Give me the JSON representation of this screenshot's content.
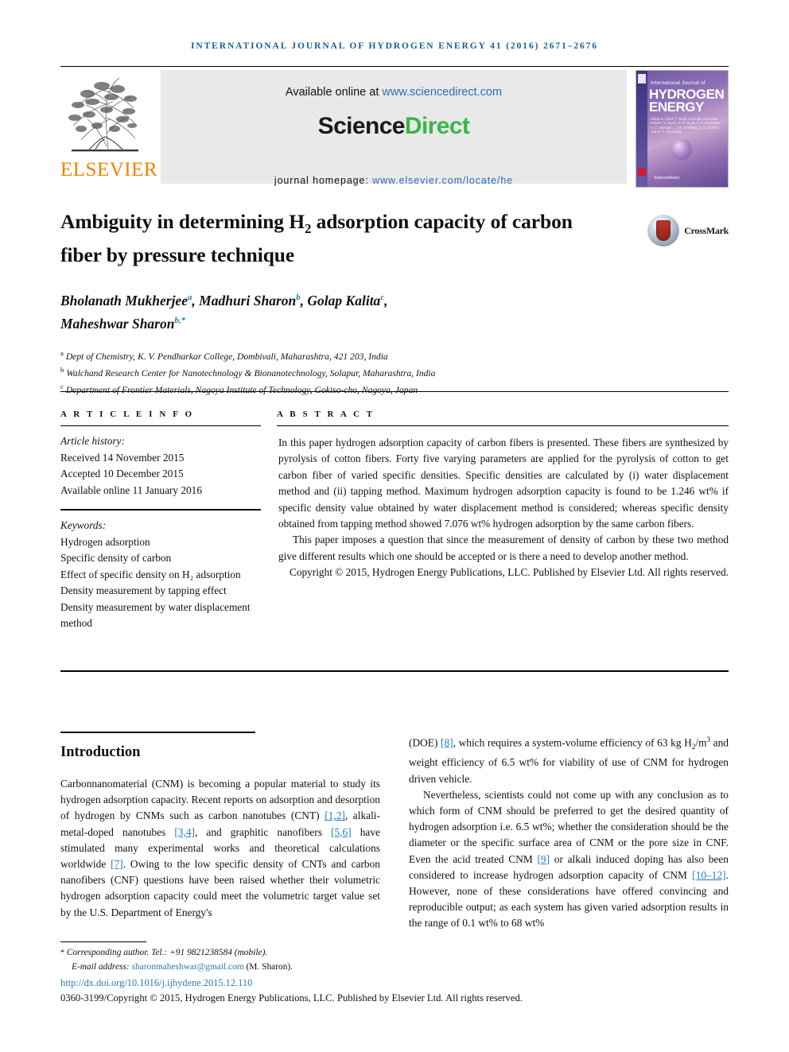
{
  "running_head": "INTERNATIONAL JOURNAL OF HYDROGEN ENERGY 41 (2016) 2671–2676",
  "header": {
    "publisher_name": "ELSEVIER",
    "available_prefix": "Available online at ",
    "sciencedirect_url": "www.sciencedirect.com",
    "sciencedirect_logo_part1": "Science",
    "sciencedirect_logo_part2": "Direct",
    "homepage_prefix": "journal homepage: ",
    "homepage_url": "www.elsevier.com/locate/he",
    "cover": {
      "top_small": "International Journal of",
      "title_line1": "HYDROGEN",
      "title_line2": "ENERGY",
      "editors": "Editor-in-Chief: T. Nejat Veziroğlu    Associate Editors: S. Dunn, D. S. Scott, A. S. Pedersen, A. C. Marsden, J. W. Sheffield, J. O. Bockris and D. A. Stevanidis",
      "science_direct": "ScienceDirect"
    }
  },
  "article": {
    "title_part1": "Ambiguity in determining H",
    "title_sub": "2",
    "title_part2": " adsorption capacity of carbon fiber by pressure technique",
    "crossmark_label": "CrossMark",
    "authors": [
      {
        "name": "Bholanath Mukherjee",
        "sup": "a",
        "sep": ", "
      },
      {
        "name": "Madhuri Sharon",
        "sup": "b",
        "sep": ", "
      },
      {
        "name": "Golap Kalita",
        "sup": "c",
        "sep": ", "
      },
      {
        "name": "Maheshwar Sharon",
        "sup": "b,*",
        "sep": ""
      }
    ],
    "affiliations": [
      {
        "mark": "a",
        "text": "Dept of Chemistry, K. V. Pendharkar College, Dombivali, Maharashtra, 421 203, India"
      },
      {
        "mark": "b",
        "text": "Walchand Research Center for Nanotechnology & Bionanotechnology, Solapur, Maharashtra, India"
      },
      {
        "mark": "c",
        "text": "Department of Frontier Materials, Nagoya Institute of Technology, Gokiso-cho, Nagoya, Japan"
      }
    ]
  },
  "article_info": {
    "heading": "A R T I C L E   I N F O",
    "history_label": "Article history:",
    "history": [
      "Received 14 November 2015",
      "Accepted 10 December 2015",
      "Available online 11 January 2016"
    ],
    "keywords_label": "Keywords:",
    "keywords": [
      "Hydrogen adsorption",
      "Specific density of carbon",
      "Effect of specific density on H₂ adsorption",
      "Density measurement by tapping effect",
      "Density measurement by water displacement method"
    ]
  },
  "abstract": {
    "heading": "A B S T R A C T",
    "paragraph1": "In this paper hydrogen adsorption capacity of carbon fibers is presented. These fibers are synthesized by pyrolysis of cotton fibers. Forty five varying parameters are applied for the pyrolysis of cotton to get carbon fiber of varied specific densities. Specific densities are calculated by (i) water displacement method and (ii) tapping method. Maximum hydrogen adsorption capacity is found to be 1.246 wt% if specific density value obtained by water displacement method is considered; whereas specific density obtained from tapping method showed 7.076 wt% hydrogen adsorption by the same carbon fibers.",
    "paragraph2": "This paper imposes a question that since the measurement of density of carbon by these two method give different results which one should be accepted or is there a need to develop another method.",
    "copyright": "Copyright © 2015, Hydrogen Energy Publications, LLC. Published by Elsevier Ltd. All rights reserved."
  },
  "body": {
    "section_title": "Introduction",
    "left_paragraph_before_ref1": "Carbonnanomaterial (CNM) is becoming a popular material to study its hydrogen adsorption capacity. Recent reports on adsorption and desorption of hydrogen by CNMs such as carbon nanotubes (CNT) ",
    "ref1": "[1,2]",
    "left_mid1": ", alkali-metal-doped nanotubes ",
    "ref2": "[3,4]",
    "left_mid2": ", and graphitic nanofibers ",
    "ref3": "[5,6]",
    "left_mid3": " have stimulated many experimental works and theoretical calculations worldwide ",
    "ref4": "[7]",
    "left_end": ". Owing to the low specific density of CNTs and carbon nanofibers (CNF) questions have been raised whether their volumetric hydrogen adsorption capacity could meet the volumetric target value set by the U.S. Department of Energy's",
    "right_start": "(DOE) ",
    "ref5": "[8]",
    "right_after_ref5_a": ", which requires a system-volume efficiency of 63 kg H",
    "right_sub_2": "2",
    "right_after_ref5_b": "/m",
    "right_sup_3": "3",
    "right_after_ref5_c": " and weight efficiency of 6.5 wt% for viability of use of CNM for hydrogen driven vehicle.",
    "right_p2_a": "Nevertheless, scientists could not come up with any conclusion as to which form of CNM should be preferred to get the desired quantity of hydrogen adsorption i.e. 6.5 wt%; whether the consideration should be the diameter or the specific surface area of CNM or the pore size in CNF. Even the acid treated CNM ",
    "ref6": "[9]",
    "right_p2_b": " or alkali induced doping has also been considered to increase hydrogen adsorption capacity of CNM ",
    "ref7": "[10–12]",
    "right_p2_c": ". However, none of these considerations have offered convincing and reproducible output; as each system has given varied adsorption results in the range of 0.1 wt% to 68 wt%"
  },
  "footer": {
    "corresponding_star": "*",
    "corresponding": " Corresponding author. Tel.: +91 9821238584 (mobile).",
    "email_label": "E-mail address: ",
    "email": "sharonmaheshwar@gmail.com",
    "email_suffix": " (M. Sharon).",
    "doi": "http://dx.doi.org/10.1016/j.ijhydene.2015.12.110",
    "issn_copyright": "0360-3199/Copyright © 2015, Hydrogen Energy Publications, LLC. Published by Elsevier Ltd. All rights reserved."
  }
}
